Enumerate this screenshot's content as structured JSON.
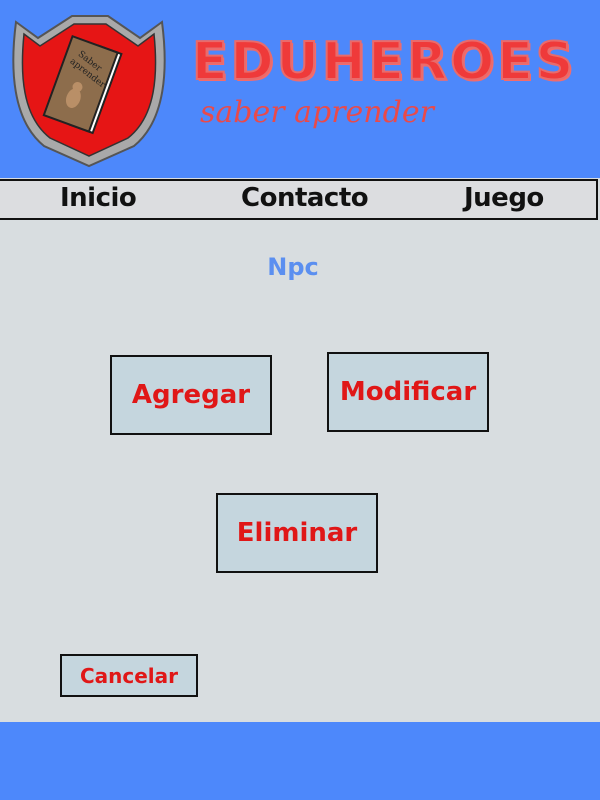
{
  "brand": {
    "title": "EDUHEROES",
    "slogan": "saber aprender",
    "logo_book_text": "Saber aprender",
    "colors": {
      "header": "#4d88fb",
      "shield": "#e01717",
      "accent": "#e01717",
      "title_link": "#5b8ff0"
    }
  },
  "nav": {
    "items": [
      {
        "label": "Inicio"
      },
      {
        "label": "Contacto"
      },
      {
        "label": "Juego"
      }
    ]
  },
  "main": {
    "title": "Npc",
    "buttons": {
      "add": "Agregar",
      "modify": "Modificar",
      "delete": "Eliminar",
      "cancel": "Cancelar"
    }
  }
}
